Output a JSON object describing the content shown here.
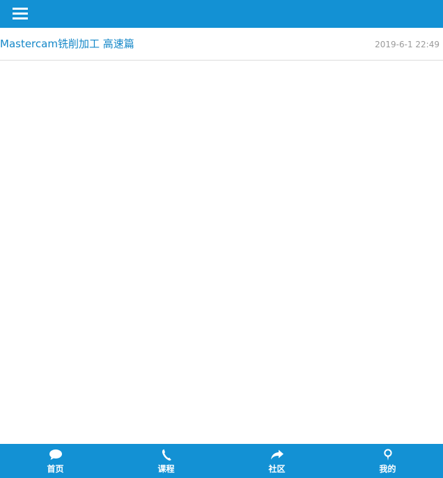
{
  "header": {
    "menu_icon": "hamburger-menu-icon"
  },
  "list": {
    "items": [
      {
        "title": "Mastercam铣削加工 高速篇",
        "date": "2019-6-1 22:49"
      }
    ]
  },
  "tabbar": {
    "tabs": [
      {
        "label": "首页",
        "icon": "chat-bubble-icon"
      },
      {
        "label": "课程",
        "icon": "phone-icon"
      },
      {
        "label": "社区",
        "icon": "share-arrow-icon"
      },
      {
        "label": "我的",
        "icon": "map-pin-icon"
      }
    ]
  },
  "colors": {
    "brand_blue": "#1391d4",
    "title_blue": "#1487c8",
    "date_gray": "#9a9a9a",
    "divider": "#dcdcdc"
  }
}
